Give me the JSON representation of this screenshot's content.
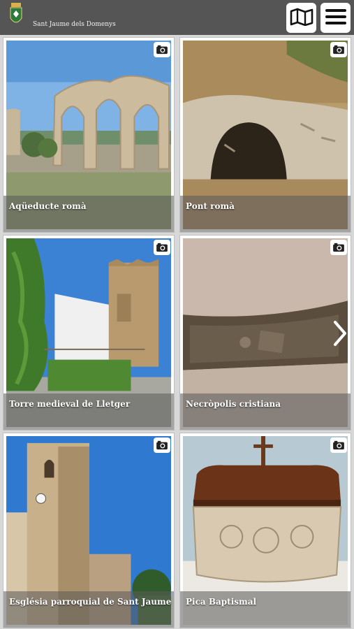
{
  "header": {
    "town_name": "Sant Jaume dels Domenys",
    "logo_icon": "town-shield-icon",
    "map_icon": "map-icon",
    "menu_icon": "hamburger-menu-icon"
  },
  "cards": [
    {
      "title": "Aqüeducte romà",
      "icon": "camera-icon"
    },
    {
      "title": "Pont romà",
      "icon": "camera-icon"
    },
    {
      "title": "Torre medieval de Lletger",
      "icon": "camera-icon"
    },
    {
      "title": "Necròpolis cristiana",
      "icon": "camera-icon"
    },
    {
      "title": "Església parroquial de Sant Jaume",
      "icon": "camera-icon"
    },
    {
      "title": "Pica Baptismal",
      "icon": "camera-icon"
    }
  ],
  "carousel": {
    "next_icon": "chevron-right-icon"
  },
  "colors": {
    "header_bg": "#555555",
    "caption_band": "#5a5a5a",
    "card_bg": "#ffffff"
  }
}
